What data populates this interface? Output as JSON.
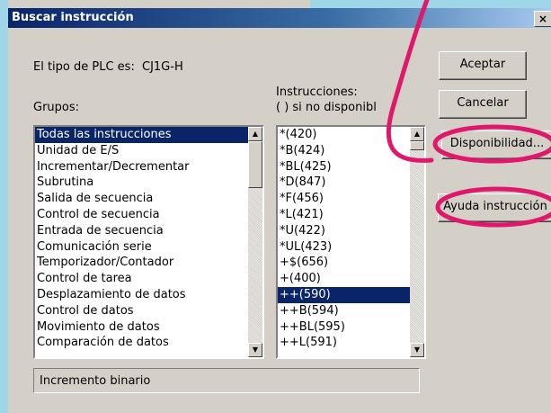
{
  "window": {
    "title": "Buscar instrucción",
    "close_label": "×"
  },
  "plc": {
    "label": "El tipo de PLC es:",
    "value": "CJ1G-H"
  },
  "groups": {
    "label": "Grupos:",
    "items": [
      "Todas las instrucciones",
      "Unidad de E/S",
      "Incrementar/Decrementar",
      "Subrutina",
      "Salida de secuencia",
      "Control de secuencia",
      "Entrada de secuencia",
      "Comunicación serie",
      "Temporizador/Contador",
      "Control de tarea",
      "Desplazamiento de datos",
      "Control de datos",
      "Movimiento de datos",
      "Comparación de datos"
    ],
    "selected_index": 0
  },
  "instructions": {
    "label_line1": "Instrucciones:",
    "label_line2": "( ) si no disponibl",
    "items": [
      "*(420)",
      "*B(424)",
      "*BL(425)",
      "*D(847)",
      "*F(456)",
      "*L(421)",
      "*U(422)",
      "*UL(423)",
      "+$(656)",
      "+(400)",
      "++(590)",
      "++B(594)",
      "++BL(595)",
      "++L(591)"
    ],
    "selected_index": 10
  },
  "buttons": {
    "accept": "Aceptar",
    "cancel": "Cancelar",
    "availability": "Disponibilidad...",
    "help": "Ayuda instrucción"
  },
  "status": {
    "text": "Incremento binario"
  },
  "colors": {
    "annotation": "#e0186c",
    "selection": "#0a246a"
  },
  "icons": {
    "scroll_up": "▲",
    "scroll_down": "▼"
  }
}
